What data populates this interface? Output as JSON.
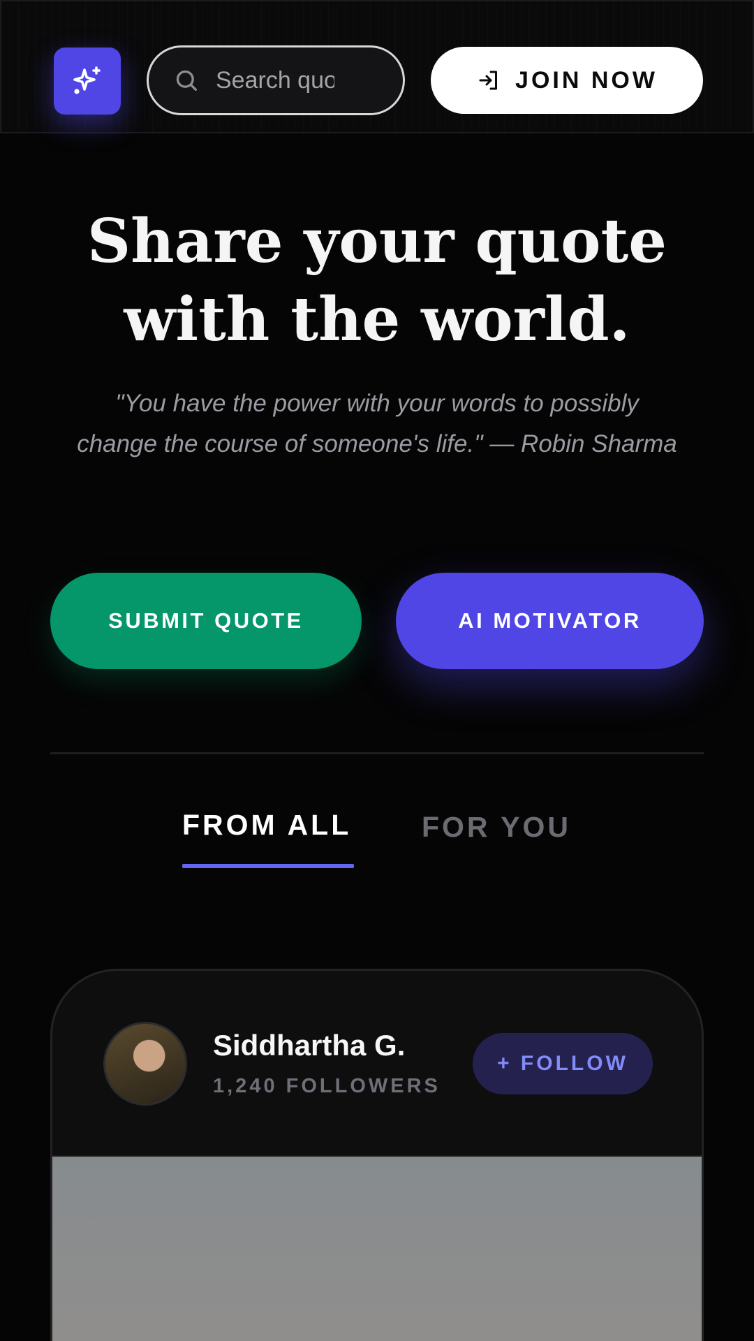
{
  "header": {
    "logo_icon": "sparkles-icon",
    "search": {
      "placeholder": "Search quotes",
      "icon": "search-icon"
    },
    "join_button": {
      "label": "JOIN NOW",
      "icon": "log-in-icon"
    }
  },
  "hero": {
    "title_line1": "Share your quote",
    "title_line2": "with the world.",
    "quote": "\"You have the power with your words to possibly change the course of someone's life.\" — Robin Sharma"
  },
  "actions": {
    "submit_label": "SUBMIT QUOTE",
    "ai_label": "AI MOTIVATOR"
  },
  "tabs": [
    {
      "label": "FROM ALL",
      "active": true
    },
    {
      "label": "FOR YOU",
      "active": false
    }
  ],
  "feed": {
    "card": {
      "user_name": "Siddhartha G.",
      "followers": "1,240 FOLLOWERS",
      "follow_label": "+ FOLLOW"
    }
  },
  "colors": {
    "accent": "#4f46e5",
    "success": "#059669",
    "background": "#050505"
  }
}
